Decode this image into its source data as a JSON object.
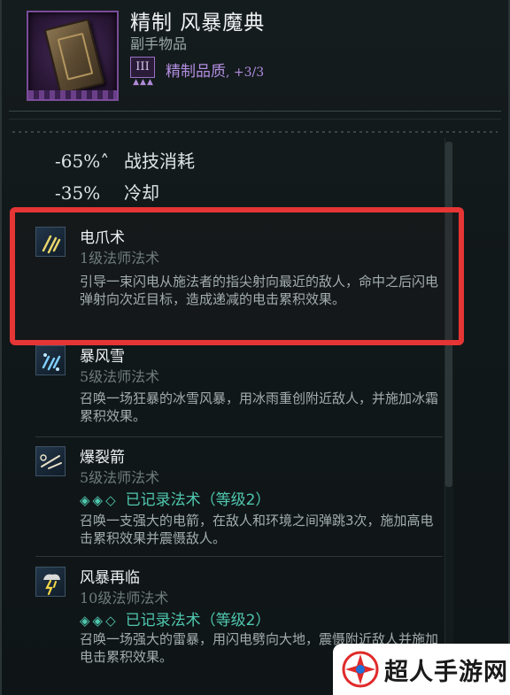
{
  "item": {
    "title": "精制 风暴魔典",
    "type": "副手物品",
    "tier_numeral": "III",
    "tier_pips": "▲▲▲",
    "quality_label": "精制品质",
    "quality_value": ", +3/3"
  },
  "stats": [
    {
      "value": "-65%˄",
      "label": "战技消耗"
    },
    {
      "value": "-35%",
      "label": "冷却"
    }
  ],
  "skills": [
    {
      "name": "电爪术",
      "level": "1级法师法术",
      "description": "引导一束闪电从施法者的指尖射向最近的敌人，命中之后闪电弹射向次近目标，造成递减的电击累积效果。"
    },
    {
      "name": "暴风雪",
      "level": "5级法师法术",
      "description": "召唤一场狂暴的冰雪风暴，用冰雨重创附近敌人，并施加冰霜累积效果。"
    },
    {
      "name": "爆裂箭",
      "level": "5级法师法术",
      "recorded_gems": "◈◈◇",
      "recorded_label": "已记录法术（等级2）",
      "description": "召唤一支强大的电箭，在敌人和环境之间弹跳3次，施加高电击累积效果并震慑敌人。"
    },
    {
      "name": "风暴再临",
      "level": "10级法师法术",
      "recorded_gems": "◈◈◇",
      "recorded_label": "已记录法术（等级2）",
      "description": "召唤一场强大的雷暴，用闪电劈向大地，震慑附近敌人并施加电击累积效果。"
    }
  ],
  "watermark": {
    "text": "超人手游网"
  },
  "colors": {
    "highlight": "#e53535",
    "quality": "#b28de0",
    "recorded": "#4fc7ae"
  }
}
